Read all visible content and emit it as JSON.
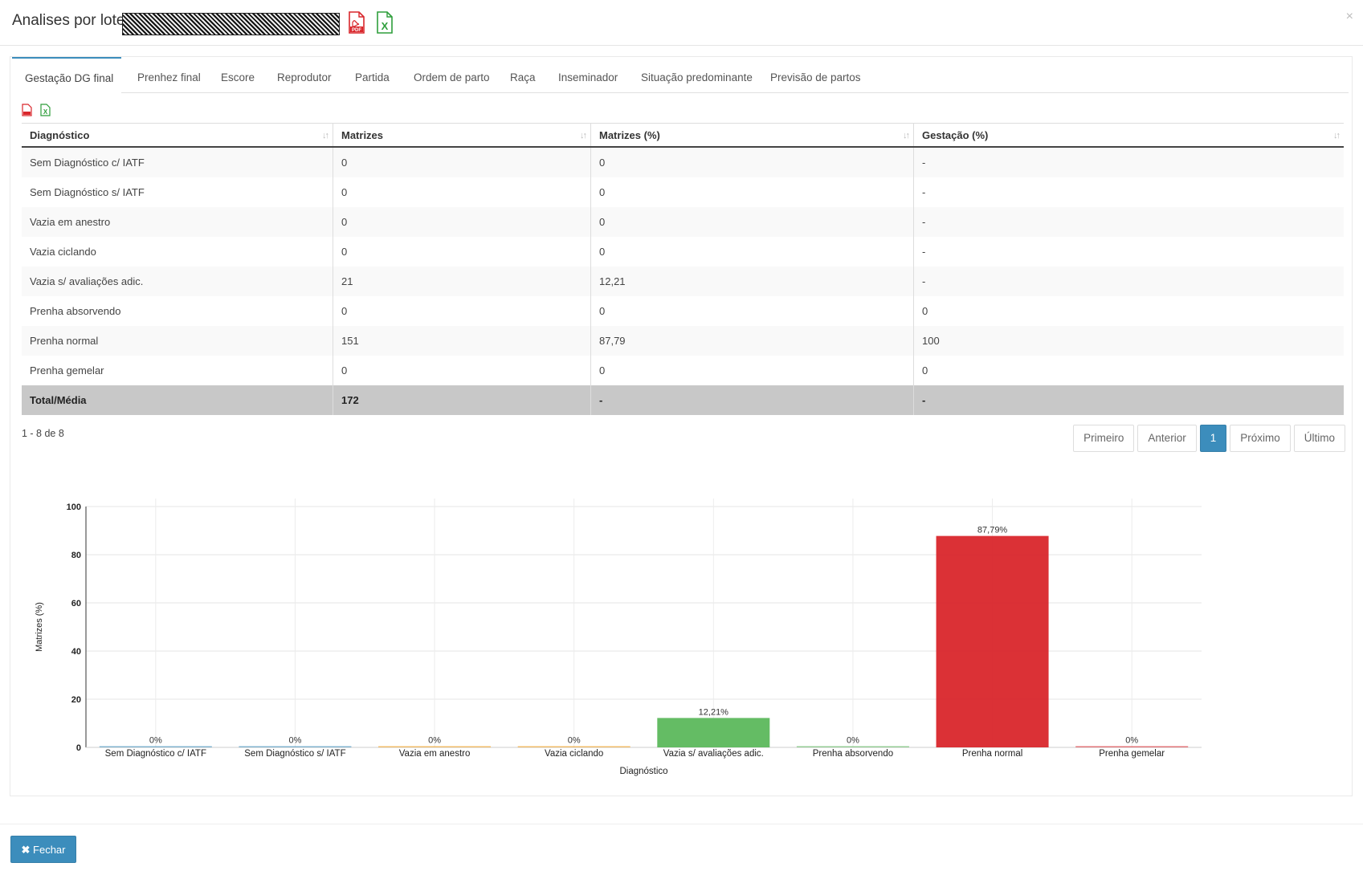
{
  "header": {
    "title": "Analises por lotes",
    "pdf_icon": "pdf-file-icon",
    "excel_icon": "excel-file-icon",
    "close_symbol": "×"
  },
  "tabs": [
    {
      "label": "Gestação DG final"
    },
    {
      "label": "Prenhez final"
    },
    {
      "label": "Escore"
    },
    {
      "label": "Reprodutor"
    },
    {
      "label": "Partida"
    },
    {
      "label": "Ordem de parto"
    },
    {
      "label": "Raça"
    },
    {
      "label": "Inseminador"
    },
    {
      "label": "Situação predominante"
    },
    {
      "label": "Previsão de partos"
    }
  ],
  "table": {
    "columns": [
      "Diagnóstico",
      "Matrizes",
      "Matrizes (%)",
      "Gestação (%)"
    ],
    "rows": [
      [
        "Sem Diagnóstico c/ IATF",
        "0",
        "0",
        "-"
      ],
      [
        "Sem Diagnóstico s/ IATF",
        "0",
        "0",
        "-"
      ],
      [
        "Vazia em anestro",
        "0",
        "0",
        "-"
      ],
      [
        "Vazia ciclando",
        "0",
        "0",
        "-"
      ],
      [
        "Vazia s/ avaliações adic.",
        "21",
        "12,21",
        "-"
      ],
      [
        "Prenha absorvendo",
        "0",
        "0",
        "0"
      ],
      [
        "Prenha normal",
        "151",
        "87,79",
        "100"
      ],
      [
        "Prenha gemelar",
        "0",
        "0",
        "0"
      ]
    ],
    "total": [
      "Total/Média",
      "172",
      "-",
      "-"
    ]
  },
  "pagination": {
    "info": "1 - 8 de 8",
    "first": "Primeiro",
    "prev": "Anterior",
    "current": "1",
    "next": "Próximo",
    "last": "Último"
  },
  "chart_data": {
    "type": "bar",
    "categories": [
      "Sem Diagnóstico c/ IATF",
      "Sem Diagnóstico s/ IATF",
      "Vazia em anestro",
      "Vazia ciclando",
      "Vazia s/ avaliações adic.",
      "Prenha absorvendo",
      "Prenha normal",
      "Prenha gemelar"
    ],
    "values": [
      0,
      0,
      0,
      0,
      12.21,
      0,
      87.79,
      0
    ],
    "data_labels": [
      "0%",
      "0%",
      "0%",
      "0%",
      "12,21%",
      "0%",
      "87,79%",
      "0%"
    ],
    "colors": [
      "#3c8dbc",
      "#3c8dbc",
      "#f39c12",
      "#f39c12",
      "#5cb85c",
      "#5cb85c",
      "#d9262b",
      "#d9262b"
    ],
    "title": "",
    "xlabel": "Diagnóstico",
    "ylabel": "Matrizes (%)",
    "ylim": [
      0,
      100
    ],
    "yticks": [
      0,
      20,
      40,
      60,
      80,
      100
    ],
    "grid": true
  },
  "footer": {
    "close_label": "Fechar",
    "close_icon": "times-icon"
  }
}
